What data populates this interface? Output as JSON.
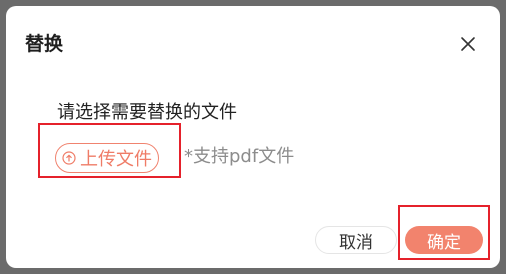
{
  "dialog": {
    "title": "替换",
    "prompt": "请选择需要替换的文件",
    "upload_label": "上传文件",
    "hint": "*支持pdf文件",
    "cancel_label": "取消",
    "confirm_label": "确定"
  },
  "icons": {
    "close": "close-icon",
    "upload": "upload-icon"
  },
  "colors": {
    "accent": "#f2836d",
    "highlight_box": "#e5212b"
  }
}
